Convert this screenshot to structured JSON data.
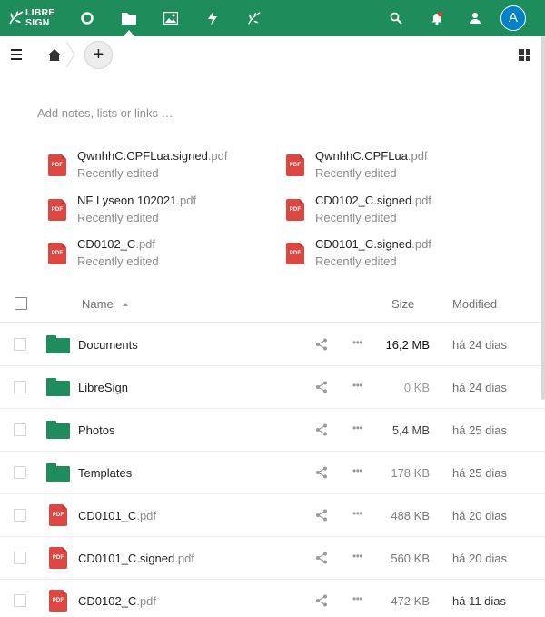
{
  "topbar": {
    "logo_line1": "LIBRE",
    "logo_line2": "SIGN",
    "brand_color": "#1f8c5b",
    "apps": [
      {
        "name": "dashboard",
        "icon": "circle-icon"
      },
      {
        "name": "files",
        "icon": "folder-icon",
        "active": true
      },
      {
        "name": "photos",
        "icon": "image-icon"
      },
      {
        "name": "activity",
        "icon": "lightning-icon"
      },
      {
        "name": "libresign",
        "icon": "leaf-icon"
      }
    ],
    "avatar_initial": "A",
    "avatar_color": "#0082c9"
  },
  "controls": {
    "add_label": "+"
  },
  "notes": {
    "placeholder": "Add notes, lists or links …"
  },
  "recent": [
    {
      "base": "QwnhhC.CPFLua.signed",
      "ext": ".pdf",
      "sub": "Recently edited"
    },
    {
      "base": "QwnhhC.CPFLua",
      "ext": ".pdf",
      "sub": "Recently edited"
    },
    {
      "base": "NF Lyseon 102021",
      "ext": ".pdf",
      "sub": "Recently edited"
    },
    {
      "base": "CD0102_C.signed",
      "ext": ".pdf",
      "sub": "Recently edited"
    },
    {
      "base": "CD0102_C",
      "ext": ".pdf",
      "sub": "Recently edited"
    },
    {
      "base": "CD0101_C.signed",
      "ext": ".pdf",
      "sub": "Recently edited"
    }
  ],
  "pdf_badge": "PDF",
  "table": {
    "col_name": "Name",
    "col_size": "Size",
    "col_modified": "Modified",
    "rows": [
      {
        "type": "folder",
        "base": "Documents",
        "ext": "",
        "size": "16,2 MB",
        "size_color": "#111111",
        "size_bold": true,
        "modified": "há 24 dias",
        "mod_color": "#6e6e6e"
      },
      {
        "type": "folder",
        "base": "LibreSign",
        "ext": "",
        "size": "0 KB",
        "size_color": "#9a9a9a",
        "modified": "há 24 dias",
        "mod_color": "#6e6e6e"
      },
      {
        "type": "folder",
        "base": "Photos",
        "ext": "",
        "size": "5,4 MB",
        "size_color": "#444444",
        "modified": "há 25 dias",
        "mod_color": "#6e6e6e"
      },
      {
        "type": "folder",
        "base": "Templates",
        "ext": "",
        "size": "178 KB",
        "size_color": "#8a8a8a",
        "modified": "há 25 dias",
        "mod_color": "#6e6e6e"
      },
      {
        "type": "pdf",
        "base": "CD0101_C",
        "ext": ".pdf",
        "size": "488 KB",
        "size_color": "#7a7a7a",
        "modified": "há 20 dias",
        "mod_color": "#6e6e6e"
      },
      {
        "type": "pdf",
        "base": "CD0101_C.signed",
        "ext": ".pdf",
        "size": "560 KB",
        "size_color": "#7a7a7a",
        "modified": "há 20 dias",
        "mod_color": "#6e6e6e"
      },
      {
        "type": "pdf",
        "base": "CD0102_C",
        "ext": ".pdf",
        "size": "472 KB",
        "size_color": "#7a7a7a",
        "modified": "há 11 dias",
        "mod_color": "#333333"
      }
    ]
  }
}
